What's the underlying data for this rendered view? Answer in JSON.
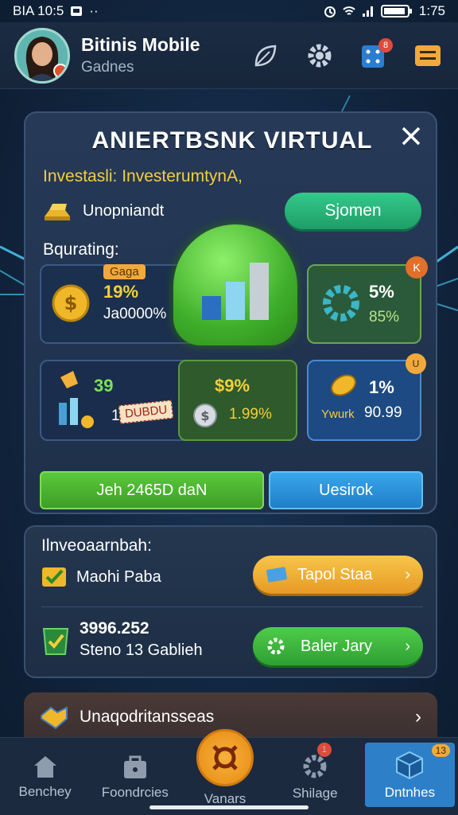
{
  "status_bar": {
    "left_text": "BIA 10:5",
    "time": "1:75"
  },
  "header": {
    "title": "Bitinis Mobile",
    "subtitle": "Gadnes",
    "notification_count": "8"
  },
  "main_card": {
    "title": "ANIERTBSNK VIRTUAL",
    "invest_label": "Investasli: InvesterumtynA,",
    "unop_label": "Unopniandt",
    "siomen_button": "Sjomen",
    "section_label": "Bqurating:",
    "tile_a": {
      "tag": "Gaga",
      "pct": "19%",
      "sub": "Ja0000%"
    },
    "tile_b": {
      "badge": "K",
      "pct": "5%",
      "sub": "85%"
    },
    "tile_c": {
      "value": "39",
      "ticket": "1",
      "ticket_label": "DUBDU"
    },
    "tile_d": {
      "value": "$9%",
      "sub": "1.99%"
    },
    "tile_e": {
      "badge": "U",
      "pct": "1%",
      "sub_left": "Ywurk",
      "sub_right": "90.99"
    },
    "button_left": "Jeh 2465D daN",
    "button_right": "Uesirok"
  },
  "card2": {
    "title": "Ilnveoaarnbah:",
    "row1_label": "Maohi Paba",
    "row1_button": "Tapol Staa",
    "row2_value": "3996.252",
    "row2_sub": "Steno 13 Gablieh",
    "row2_button": "Baler Jary"
  },
  "card3": {
    "label": "Unaqodritansseas"
  },
  "bottom_nav": [
    {
      "label": "Benchey"
    },
    {
      "label": "Foondrcies"
    },
    {
      "label": "Vanars"
    },
    {
      "label": "Shilage",
      "badge": "1"
    },
    {
      "label": "Dntnhes",
      "badge": "13"
    }
  ],
  "colors": {
    "accent_gold": "#f3cf3a",
    "accent_green": "#3fae2a",
    "accent_blue": "#2d80c8",
    "accent_orange": "#e78b12"
  }
}
